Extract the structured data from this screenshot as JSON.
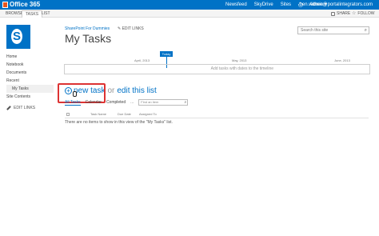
{
  "suite_bar": {
    "app_title": "Office 365",
    "nav": [
      "Newsfeed",
      "SkyDrive",
      "Sites"
    ],
    "more": "...",
    "user": "Admin ▾",
    "email": "ben.withee@portalintegrators.com",
    "help": "?"
  },
  "ribbon": {
    "tabs": [
      "BROWSE",
      "TASKS",
      "LIST"
    ],
    "share": "SHARE",
    "follow": "FOLLOW"
  },
  "header": {
    "breadcrumb": "SharePoint For Dummies",
    "edit_links": "EDIT LINKS",
    "page_title": "My Tasks",
    "search_placeholder": "Search this site"
  },
  "quicklaunch": {
    "items": [
      "Home",
      "Notebook",
      "Documents",
      "Recent"
    ],
    "recent_sub": "My Tasks",
    "site_contents": "Site Contents",
    "edit_links": "EDIT LINKS"
  },
  "timeline": {
    "today": "Today",
    "months": [
      "April, 2013",
      "May, 2013",
      "June, 2013"
    ],
    "placeholder": "Add tasks with dates to the timeline"
  },
  "list": {
    "new_task": "new task",
    "or": "or",
    "edit_list": "edit this list",
    "views": [
      "All Tasks",
      "Calendar",
      "Completed"
    ],
    "more_views": "...",
    "find_placeholder": "Find an item",
    "columns": [
      "Task Name",
      "Due Date",
      "Assigned To"
    ],
    "empty_message": "There are no items to show in this view of the \"My Tasks\" list."
  },
  "colors": {
    "suite_bar": "#0072c6",
    "link": "#0072c6",
    "highlight": "#dd3333"
  }
}
